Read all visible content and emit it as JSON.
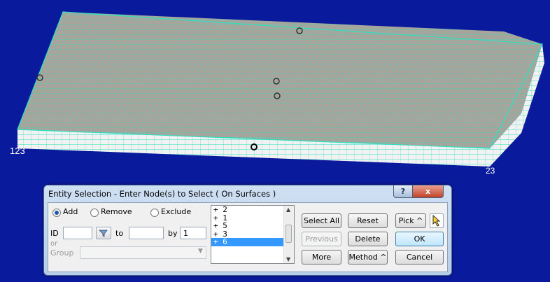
{
  "viewport": {
    "labels": {
      "left_axis": "123",
      "right_axis": "23"
    },
    "colors": {
      "background": "#0a1a9c",
      "mesh_fill": "#a8a49c",
      "mesh_lines": "#2ee0c0",
      "edge_fill": "#f2f2f2"
    }
  },
  "dialog": {
    "title": "Entity Selection - Enter Node(s) to Select  ( On Surfaces )",
    "help_label": "?",
    "close_label": "x",
    "modes": {
      "add": "Add",
      "remove": "Remove",
      "exclude": "Exclude",
      "selected": "Add"
    },
    "id_label": "ID",
    "id_value": "",
    "to_label": "to",
    "to_value": "",
    "by_label": "by",
    "by_value": "1",
    "or_label": "or",
    "group_label": "Group",
    "group_value": "",
    "list_items": [
      "+ 2",
      "+ 1",
      "+ 5",
      "+ 3",
      "+ 6"
    ],
    "selected_index": 4,
    "buttons": {
      "select_all": "Select All",
      "reset": "Reset",
      "pick": "Pick ^",
      "previous": "Previous",
      "delete": "Delete",
      "ok": "OK",
      "more": "More",
      "method": "Method ^",
      "cancel": "Cancel"
    }
  }
}
